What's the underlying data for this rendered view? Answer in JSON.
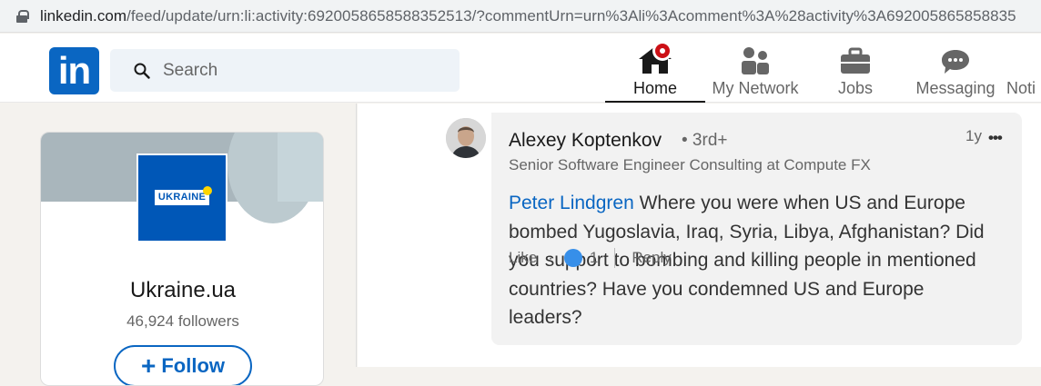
{
  "browser": {
    "url_host": "linkedin.com",
    "url_path": "/feed/update/urn:li:activity:6920058658588352513/?commentUrn=urn%3Ali%3Acomment%3A%28activity%3A692005865858835"
  },
  "nav": {
    "logo_text": "in",
    "search_placeholder": "Search",
    "items": [
      {
        "label": "Home",
        "icon": "home-icon",
        "active": true
      },
      {
        "label": "My Network",
        "icon": "network-icon"
      },
      {
        "label": "Jobs",
        "icon": "briefcase-icon"
      },
      {
        "label": "Messaging",
        "icon": "chat-icon"
      },
      {
        "label": "Noti",
        "icon": "bell-icon"
      }
    ],
    "accent": "#0a66c2",
    "badge_color": "#cc1016"
  },
  "org": {
    "logo_text": "UKRAINE",
    "logo_suffix": "ua",
    "name": "Ukraine.ua",
    "followers": "46,924 followers",
    "follow_label": "Follow",
    "follow_icon": "+",
    "brand_color": "#0057b7"
  },
  "comment": {
    "author": "Alexey Koptenkov",
    "degree": "• 3rd+",
    "headline": "Senior Software Engineer Consulting at Compute FX",
    "time": "1y",
    "more": "•••",
    "mention": "Peter Lindgren",
    "text": " Where you were when US and Europe bombed Yugoslavia, Iraq, Syria, Libya, Afghanistan? Did you support to bombing and killing people in mentioned countries? Have you condemned US and Europe leaders?",
    "like_label": "Like",
    "separator": "·",
    "reaction_count": "1",
    "reply_label": "Reply"
  }
}
